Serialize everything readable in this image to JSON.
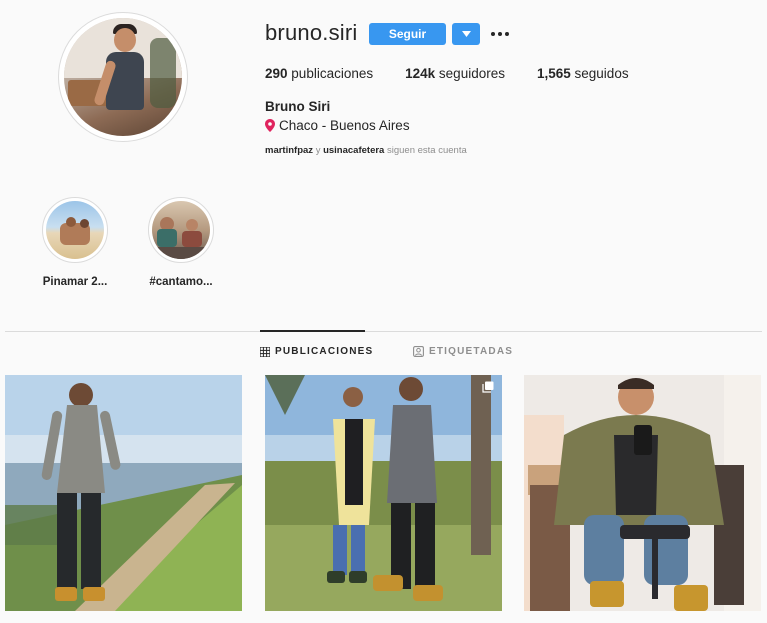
{
  "profile": {
    "username": "bruno.siri",
    "follow_label": "Seguir",
    "full_name": "Bruno Siri",
    "location": "Chaco - Buenos Aires",
    "stats": {
      "posts_count": "290",
      "posts_label": "publicaciones",
      "followers_count": "124k",
      "followers_label": "seguidores",
      "following_count": "1,565",
      "following_label": "seguidos"
    },
    "followed_by": {
      "user1": "martinfpaz",
      "connector": "y",
      "user2": "usinacafetera",
      "suffix": "siguen esta cuenta"
    }
  },
  "highlights": [
    {
      "label": "Pinamar 2..."
    },
    {
      "label": "#cantamo..."
    }
  ],
  "tabs": [
    {
      "label": "PUBLICACIONES",
      "icon": "grid-icon",
      "active": true
    },
    {
      "label": "ETIQUETADAS",
      "icon": "tag-icon",
      "active": false
    }
  ],
  "colors": {
    "accent": "#3897f0",
    "text": "#262626",
    "muted": "#8e8e8e",
    "background": "#fafafa",
    "border": "#dbdbdb",
    "location_pin": "#e0245e"
  }
}
